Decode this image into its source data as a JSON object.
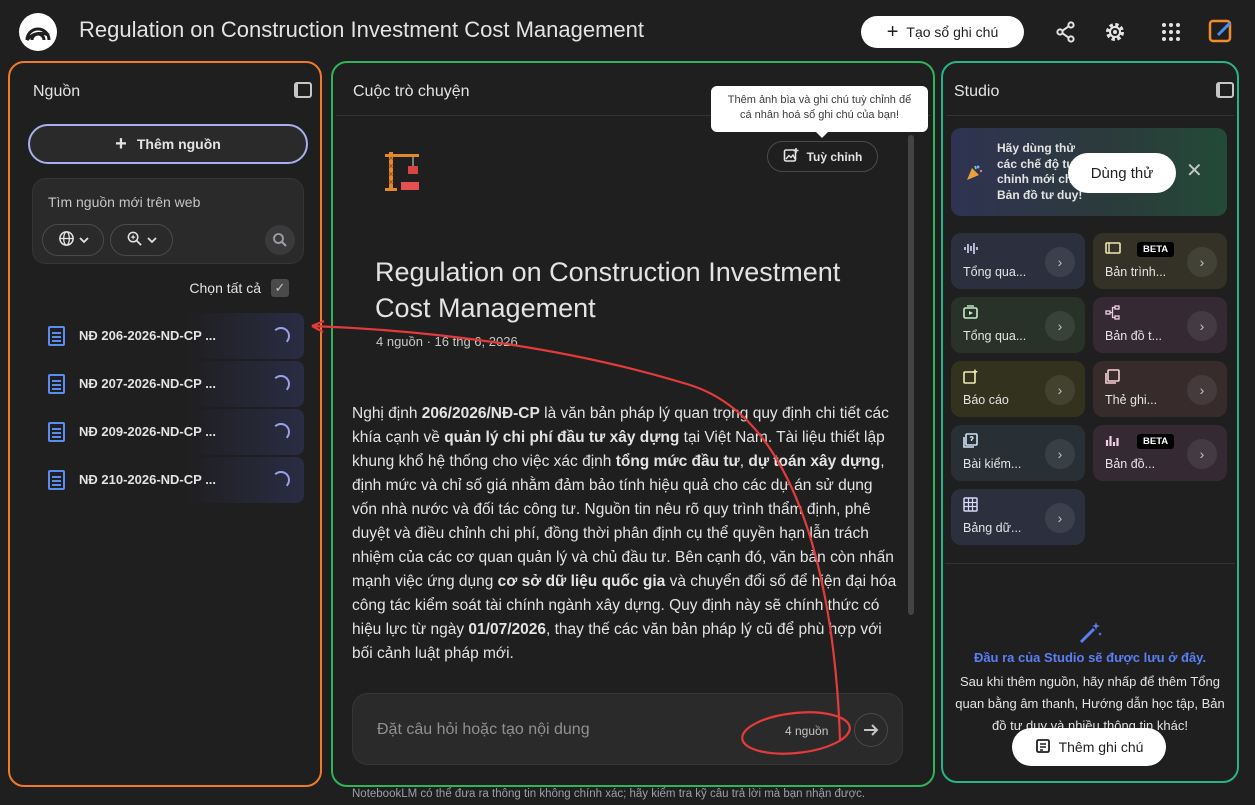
{
  "header": {
    "title": "Regulation on Construction Investment Cost Management",
    "create_notebook_label": "Tạo sổ ghi chú"
  },
  "sources_panel": {
    "title": "Nguồn",
    "add_source_label": "Thêm nguồn",
    "web_search_label": "Tìm nguồn mới trên web",
    "select_all_label": "Chọn tất cả",
    "items": [
      {
        "label": "NĐ 206-2026-ND-CP ..."
      },
      {
        "label": "NĐ 207-2026-ND-CP ..."
      },
      {
        "label": "NĐ 209-2026-ND-CP ..."
      },
      {
        "label": "NĐ 210-2026-ND-CP ..."
      }
    ]
  },
  "chat_panel": {
    "title": "Cuộc trò chuyện",
    "tooltip": "Thêm ảnh bìa và ghi chú tuỳ chỉnh để cá nhân hoá sổ ghi chú của bạn!",
    "customize_label": "Tuỳ chỉnh",
    "notebook_title": "Regulation on Construction Investment Cost Management",
    "notebook_meta": "4 nguồn · 16 thg 6, 2026",
    "summary": {
      "p1": "Nghị định ",
      "b1": "206/2026/NĐ-CP",
      "p2": " là văn bản pháp lý quan trọng quy định chi tiết các khía cạnh về ",
      "b2": "quản lý chi phí đầu tư xây dựng",
      "p3": " tại Việt Nam. Tài liệu thiết lập khung khổ hệ thống cho việc xác định ",
      "b3": "tổng mức đầu tư",
      "p4": ", ",
      "b4": "dự toán xây dựng",
      "p5": ", định mức và chỉ số giá nhằm đảm bảo tính hiệu quả cho các dự án sử dụng vốn nhà nước và đối tác công tư. Nguồn tin nêu rõ quy trình thẩm định, phê duyệt và điều chỉnh chi phí, đồng thời phân định cụ thể quyền hạn lẫn trách nhiệm của các cơ quan quản lý và chủ đầu tư. Bên cạnh đó, văn bản còn nhấn mạnh việc ứng dụng ",
      "b5": "cơ sở dữ liệu quốc gia",
      "p6": " và chuyển đổi số để hiện đại hóa công tác kiểm soát tài chính ngành xây dựng. Quy định này sẽ chính thức có hiệu lực từ ngày ",
      "b6": "01/07/2026",
      "p7": ", thay thế các văn bản pháp lý cũ để phù hợp với bối cảnh luật pháp mới."
    },
    "input_placeholder": "Đặt câu hỏi hoặc tạo nội dung",
    "source_count": "4 nguồn",
    "disclaimer": "NotebookLM có thể đưa ra thông tin không chính xác; hãy kiểm tra kỹ câu trả lời mà bạn nhận được."
  },
  "studio_panel": {
    "title": "Studio",
    "banner_text": "Hãy dùng thử các chế độ tuỳ chỉnh mới cho Bản đồ tư duy!",
    "try_label": "Dùng thử",
    "tiles": [
      {
        "label": "Tổng qua...",
        "icon": "audio-overview-icon",
        "color": "#2c2f3d"
      },
      {
        "label": "Bản trình...",
        "icon": "slides-icon",
        "color": "#343226",
        "badge": "BETA"
      },
      {
        "label": "Tổng qua...",
        "icon": "video-overview-icon",
        "color": "#283228"
      },
      {
        "label": "Bản đồ t...",
        "icon": "mind-map-icon",
        "color": "#352a33"
      },
      {
        "label": "Báo cáo",
        "icon": "report-icon",
        "color": "#33321f"
      },
      {
        "label": "Thẻ ghi...",
        "icon": "flashcards-icon",
        "color": "#372b2c"
      },
      {
        "label": "Bài kiểm...",
        "icon": "quiz-icon",
        "color": "#283036"
      },
      {
        "label": "Bản đồ...",
        "icon": "infographic-icon",
        "color": "#352a33",
        "badge": "BETA"
      },
      {
        "label": "Bảng dữ...",
        "icon": "data-table-icon",
        "color": "#2c2f3d"
      }
    ],
    "empty_title": "Đầu ra của Studio sẽ được lưu ở đây.",
    "empty_desc": "Sau khi thêm nguồn, hãy nhấp để thêm Tổng quan bằng âm thanh, Hướng dẫn học tập, Bản đồ tư duy và nhiều thông tin khác!",
    "add_note_label": "Thêm ghi chú"
  }
}
